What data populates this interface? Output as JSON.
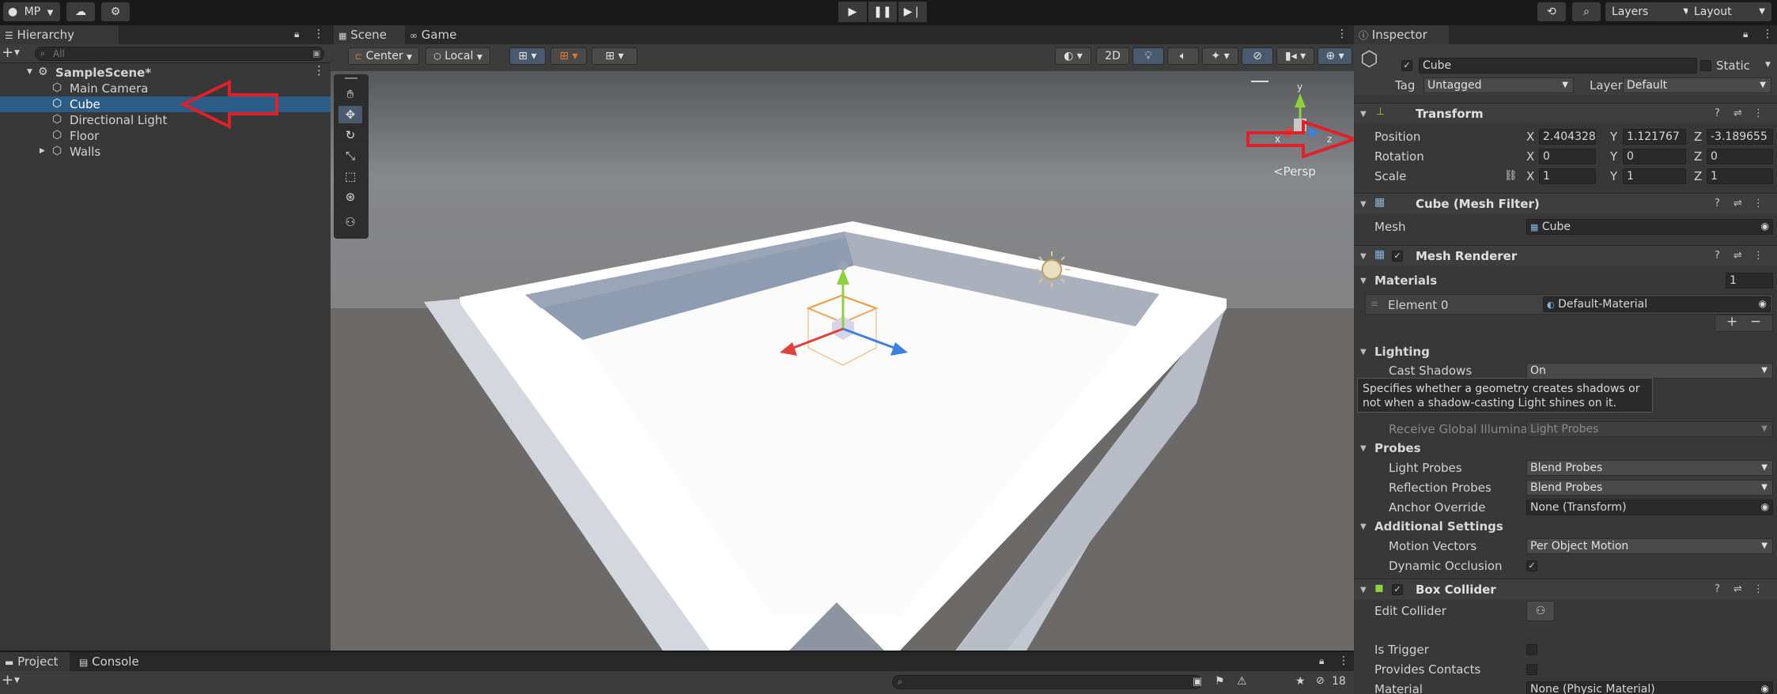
{
  "toolbar": {
    "account": "MP",
    "layers": "Layers",
    "layout": "Layout"
  },
  "hierarchy": {
    "tab": "Hierarchy",
    "search_placeholder": "All",
    "scene": "SampleScene*",
    "items": [
      {
        "label": "Main Camera",
        "selected": false,
        "expandable": false
      },
      {
        "label": "Cube",
        "selected": true,
        "expandable": false
      },
      {
        "label": "Directional Light",
        "selected": false,
        "expandable": false
      },
      {
        "label": "Floor",
        "selected": false,
        "expandable": false
      },
      {
        "label": "Walls",
        "selected": false,
        "expandable": true
      }
    ]
  },
  "scene_panel": {
    "tabs": [
      "Scene",
      "Game"
    ],
    "pivot": "Center",
    "space": "Local",
    "mode_2d": "2D",
    "persp": "<Persp",
    "gizmo_axes": {
      "x": "x",
      "y": "y",
      "z": "z"
    }
  },
  "bottom": {
    "tabs": [
      "Project",
      "Console"
    ],
    "hidden_count": "18"
  },
  "inspector": {
    "tab": "Inspector",
    "object_name": "Cube",
    "static_label": "Static",
    "tag_label": "Tag",
    "tag_value": "Untagged",
    "layer_label": "Layer",
    "layer_value": "Default",
    "transform": {
      "title": "Transform",
      "position_label": "Position",
      "rotation_label": "Rotation",
      "scale_label": "Scale",
      "position": {
        "x": "2.404328",
        "y": "1.121767",
        "z": "-3.189655"
      },
      "rotation": {
        "x": "0",
        "y": "0",
        "z": "0"
      },
      "scale": {
        "x": "1",
        "y": "1",
        "z": "1"
      }
    },
    "mesh_filter": {
      "title": "Cube (Mesh Filter)",
      "mesh_label": "Mesh",
      "mesh_value": "Cube"
    },
    "mesh_renderer": {
      "title": "Mesh Renderer",
      "materials_label": "Materials",
      "materials_count": "1",
      "element_label": "Element 0",
      "element_value": "Default-Material",
      "add": "+",
      "remove": "−",
      "lighting_label": "Lighting",
      "cast_shadows_label": "Cast Shadows",
      "cast_shadows_value": "On",
      "tooltip": "Specifies whether a geometry creates shadows or not when a shadow-casting Light shines on it.",
      "receive_gi_label": "Receive Global Illumina",
      "receive_gi_value": "Light Probes",
      "probes_label": "Probes",
      "light_probes_label": "Light Probes",
      "light_probes_value": "Blend Probes",
      "reflection_probes_label": "Reflection Probes",
      "reflection_probes_value": "Blend Probes",
      "anchor_label": "Anchor Override",
      "anchor_value": "None (Transform)",
      "additional_label": "Additional Settings",
      "motion_vectors_label": "Motion Vectors",
      "motion_vectors_value": "Per Object Motion",
      "dynamic_occlusion_label": "Dynamic Occlusion"
    },
    "box_collider": {
      "title": "Box Collider",
      "edit_label": "Edit Collider",
      "trigger_label": "Is Trigger",
      "contacts_label": "Provides Contacts",
      "material_label": "Material",
      "material_value": "None (Physic Material)"
    }
  },
  "colors": {
    "selection": "#2c5d87",
    "annotation_arrow": "#e0202a",
    "axis_x": "#e0413a",
    "axis_y": "#8fd13b",
    "axis_z": "#3b82e0"
  }
}
